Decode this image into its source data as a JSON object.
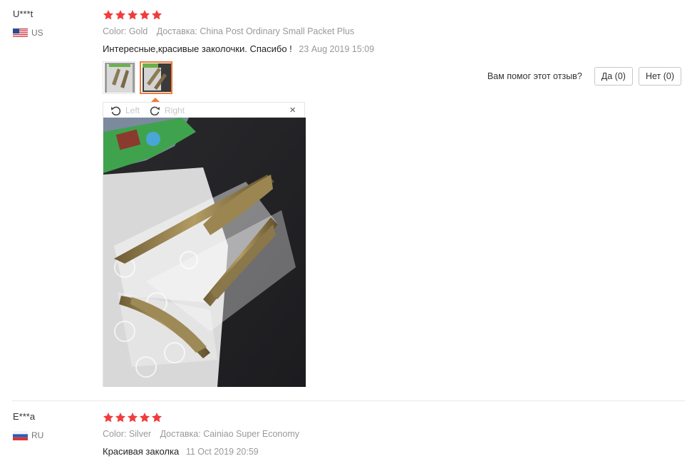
{
  "reviews": [
    {
      "user": "U***t",
      "country": "US",
      "rating": 5,
      "attributes": "Color: Gold",
      "delivery": "Доставка: China Post Ordinary Small Packet Plus",
      "feedback": "Интересные,красивые заколочки. Спасибо !",
      "date": "23 Aug 2019 15:09",
      "viewer": {
        "rotate_left": "Left",
        "rotate_right": "Right",
        "close": "×"
      },
      "helpful": {
        "question": "Вам помог этот отзыв?",
        "yes": "Да (0)",
        "no": "Нет (0)"
      }
    },
    {
      "user": "E***a",
      "country": "RU",
      "rating": 5,
      "attributes": "Color: Silver",
      "delivery": "Доставка: Cainiao Super Economy",
      "feedback": "Красивая заколка",
      "date": "11 Oct 2019 20:59"
    }
  ],
  "colors": {
    "star": "#f03c3c",
    "thumb_active_border": "#f07b3b"
  },
  "icons": [
    "star-icon",
    "us-flag-icon",
    "ru-flag-icon",
    "rotate-left-icon",
    "rotate-right-icon",
    "close-icon"
  ]
}
